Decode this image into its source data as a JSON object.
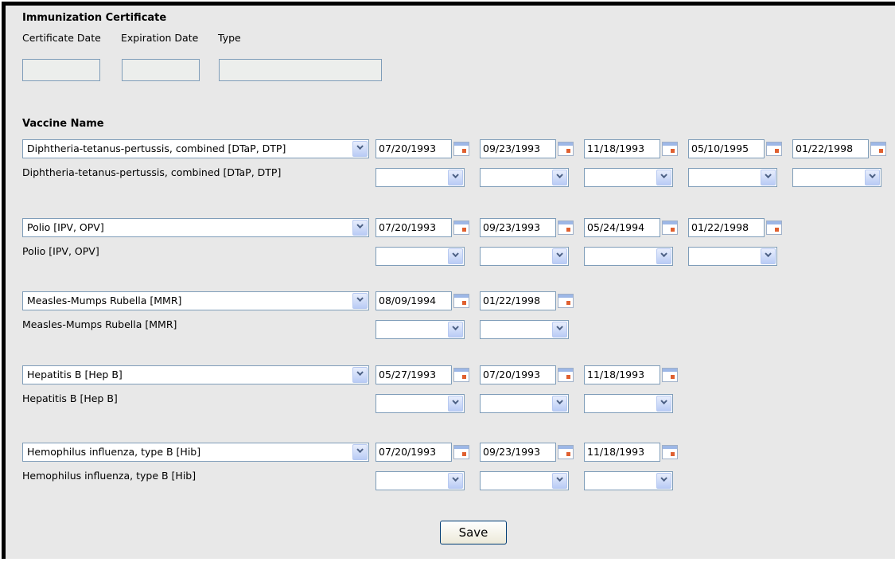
{
  "certificate": {
    "heading": "Immunization Certificate",
    "certificate_date_label": "Certificate Date",
    "expiration_date_label": "Expiration Date",
    "type_label": "Type"
  },
  "vaccine_heading": "Vaccine Name",
  "vaccines": [
    {
      "name": "Diphtheria-tetanus-pertussis, combined [DTaP, DTP]",
      "dates": [
        "07/20/1993",
        "09/23/1993",
        "11/18/1993",
        "05/10/1995",
        "01/22/1998"
      ]
    },
    {
      "name": "Polio [IPV, OPV]",
      "dates": [
        "07/20/1993",
        "09/23/1993",
        "05/24/1994",
        "01/22/1998"
      ]
    },
    {
      "name": "Measles-Mumps Rubella [MMR]",
      "dates": [
        "08/09/1994",
        "01/22/1998"
      ]
    },
    {
      "name": "Hepatitis B [Hep B]",
      "dates": [
        "05/27/1993",
        "07/20/1993",
        "11/18/1993"
      ]
    },
    {
      "name": "Hemophilus influenza, type B [Hib]",
      "dates": [
        "07/20/1993",
        "09/23/1993",
        "11/18/1993"
      ]
    }
  ],
  "save_label": "Save",
  "icons": {
    "dropdown": "chevron-down-icon",
    "calendar": "calendar-icon"
  },
  "colors": {
    "panel_background": "#e8e8e8",
    "field_border": "#7f9db9",
    "dropdown_button": "#b9cbf5"
  }
}
